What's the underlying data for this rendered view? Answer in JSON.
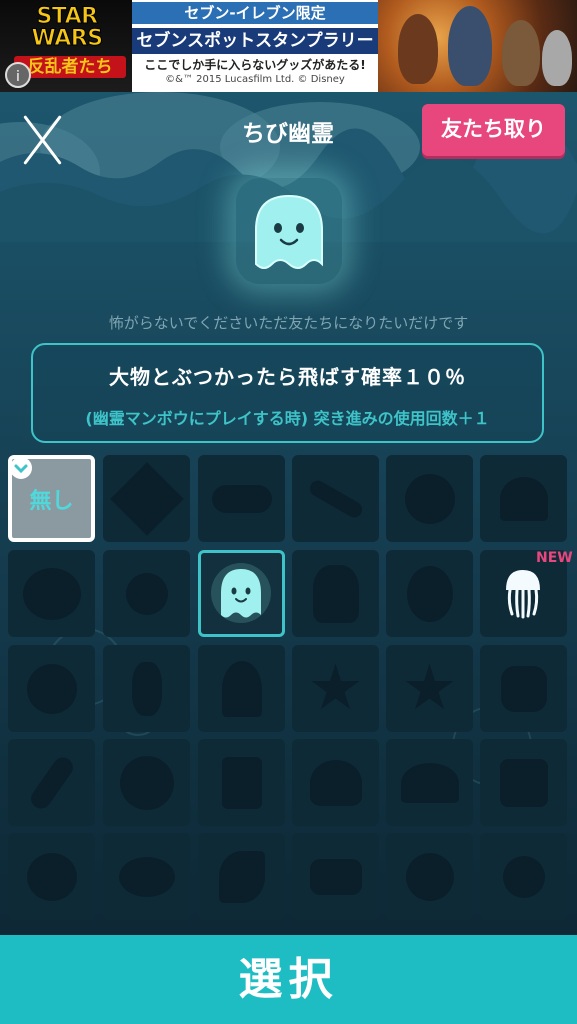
{
  "ad": {
    "logo_line1": "STAR WARS",
    "logo_line2": "反乱者たち",
    "info_icon": "i",
    "line1": "セブン-イレブン限定",
    "line2": "セブンスポットスタンプラリー",
    "line3": "ここでしか手に入らないグッズがあたる!",
    "line4": "©&™ 2015 Lucasfilm Ltd. © Disney"
  },
  "header": {
    "title": "ちび幽霊",
    "friend_button": "友たち取り"
  },
  "character": {
    "description": "怖がらないでくださいただ友たちになりたいだけです",
    "effect_main": "大物とぶつかったら飛ばす確率１０％",
    "effect_sub": "(幽霊マンボウにプレイする時) 突き進みの使用回数＋１"
  },
  "grid": {
    "none_label": "無し",
    "new_label": "NEW"
  },
  "footer": {
    "select_button": "選択"
  },
  "icons": {
    "close": "close-icon",
    "check": "check-icon",
    "ghost": "ghost-icon",
    "jellyfish": "jellyfish-icon"
  },
  "colors": {
    "accent_pink": "#e8477e",
    "accent_teal": "#1ebdc3",
    "border_teal": "#3ec3c8"
  }
}
